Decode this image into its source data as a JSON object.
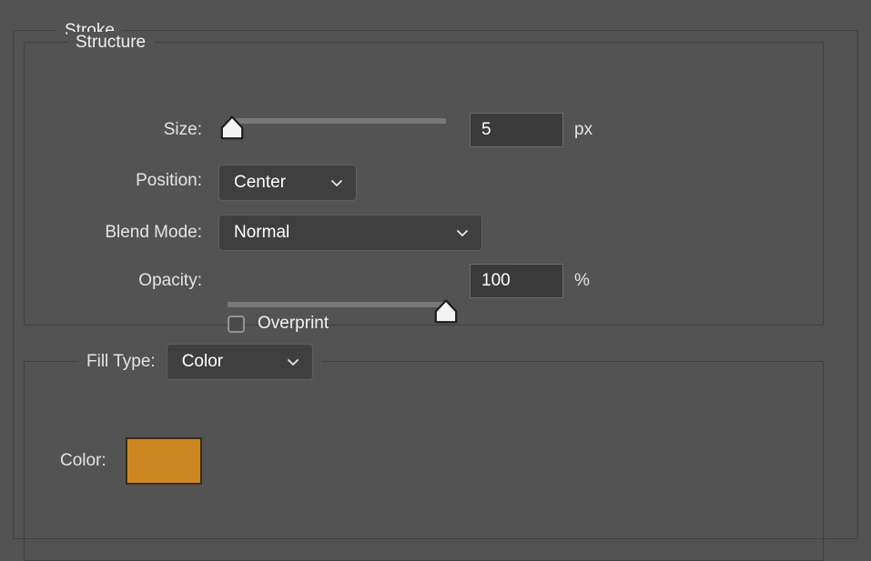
{
  "panel": {
    "title": "Stroke"
  },
  "structure": {
    "title": "Structure",
    "size": {
      "label": "Size:",
      "value": "5",
      "unit": "px",
      "slider_percent": 2,
      "handle_icon": "slider-handle-icon"
    },
    "position": {
      "label": "Position:",
      "value": "Center",
      "chevron_icon": "chevron-down-icon"
    },
    "blend_mode": {
      "label": "Blend Mode:",
      "value": "Normal",
      "chevron_icon": "chevron-down-icon"
    },
    "opacity": {
      "label": "Opacity:",
      "value": "100",
      "unit": "%",
      "slider_percent": 100,
      "handle_icon": "slider-handle-icon"
    },
    "overprint": {
      "label": "Overprint",
      "checked": false,
      "checkbox_icon": "checkbox-unchecked-icon"
    }
  },
  "fill": {
    "fill_type": {
      "label": "Fill Type:",
      "value": "Color",
      "chevron_icon": "chevron-down-icon"
    },
    "color": {
      "label": "Color:",
      "swatch_hex": "#cd8722",
      "swatch_border_hex": "#3a2d18"
    }
  },
  "theme": {
    "background_hex": "#535353",
    "group_border_hex": "#3f3f3f",
    "field_bg_hex": "#3b3b3b",
    "text_hex": "#e8e8e8",
    "track_hex": "#787878",
    "handle_hex": "#f2f2f2"
  }
}
